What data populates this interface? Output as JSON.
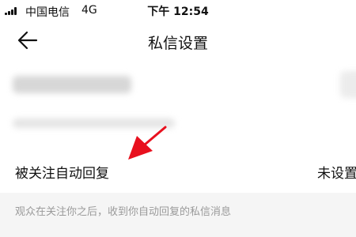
{
  "status_bar": {
    "carrier": "中国电信",
    "network": "4G",
    "time": "下午 12:54"
  },
  "header": {
    "title": "私信设置",
    "back_icon": "back-arrow-icon"
  },
  "settings": {
    "auto_reply": {
      "label": "被关注自动回复",
      "value": "未设置",
      "hint": "观众在关注你之后，收到你自动回复的私信消息"
    }
  },
  "annotation": {
    "arrow_color": "#e8101e"
  },
  "colors": {
    "page_background": "#f5f5f5",
    "card_background": "#ffffff",
    "hint_text": "#9a9a9a"
  }
}
